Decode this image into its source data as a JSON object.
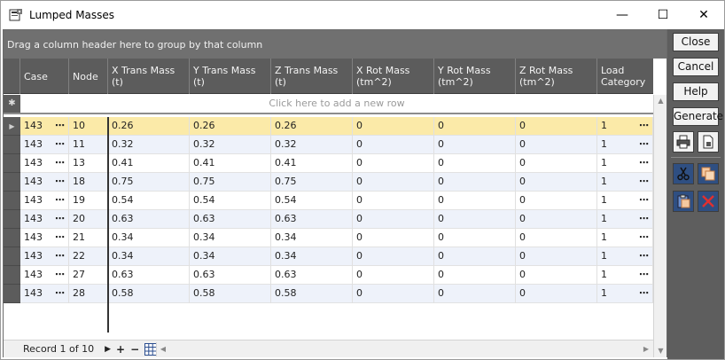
{
  "window": {
    "title": "Lumped Masses",
    "min_label": "—",
    "max_label": "☐",
    "close_label": "✕"
  },
  "grid": {
    "group_hint": "Drag a column header here to group by that column",
    "new_row_hint": "Click here to add a new row",
    "columns": [
      {
        "key": "case",
        "label": "Case"
      },
      {
        "key": "node",
        "label": "Node"
      },
      {
        "key": "xtm",
        "label": "X Trans Mass\n(t)"
      },
      {
        "key": "ytm",
        "label": "Y Trans Mass\n(t)"
      },
      {
        "key": "ztm",
        "label": "Z Trans Mass\n(t)"
      },
      {
        "key": "xrm",
        "label": "X Rot Mass\n(tm^2)"
      },
      {
        "key": "yrm",
        "label": "Y Rot Mass\n(tm^2)"
      },
      {
        "key": "zrm",
        "label": "Z Rot Mass\n(tm^2)"
      },
      {
        "key": "lc",
        "label": "Load\nCategory"
      }
    ],
    "rows": [
      {
        "case": "143",
        "node": "10",
        "xtm": "0.26",
        "ytm": "0.26",
        "ztm": "0.26",
        "xrm": "0",
        "yrm": "0",
        "zrm": "0",
        "lc": "1"
      },
      {
        "case": "143",
        "node": "11",
        "xtm": "0.32",
        "ytm": "0.32",
        "ztm": "0.32",
        "xrm": "0",
        "yrm": "0",
        "zrm": "0",
        "lc": "1"
      },
      {
        "case": "143",
        "node": "13",
        "xtm": "0.41",
        "ytm": "0.41",
        "ztm": "0.41",
        "xrm": "0",
        "yrm": "0",
        "zrm": "0",
        "lc": "1"
      },
      {
        "case": "143",
        "node": "18",
        "xtm": "0.75",
        "ytm": "0.75",
        "ztm": "0.75",
        "xrm": "0",
        "yrm": "0",
        "zrm": "0",
        "lc": "1"
      },
      {
        "case": "143",
        "node": "19",
        "xtm": "0.54",
        "ytm": "0.54",
        "ztm": "0.54",
        "xrm": "0",
        "yrm": "0",
        "zrm": "0",
        "lc": "1"
      },
      {
        "case": "143",
        "node": "20",
        "xtm": "0.63",
        "ytm": "0.63",
        "ztm": "0.63",
        "xrm": "0",
        "yrm": "0",
        "zrm": "0",
        "lc": "1"
      },
      {
        "case": "143",
        "node": "21",
        "xtm": "0.34",
        "ytm": "0.34",
        "ztm": "0.34",
        "xrm": "0",
        "yrm": "0",
        "zrm": "0",
        "lc": "1"
      },
      {
        "case": "143",
        "node": "22",
        "xtm": "0.34",
        "ytm": "0.34",
        "ztm": "0.34",
        "xrm": "0",
        "yrm": "0",
        "zrm": "0",
        "lc": "1"
      },
      {
        "case": "143",
        "node": "27",
        "xtm": "0.63",
        "ytm": "0.63",
        "ztm": "0.63",
        "xrm": "0",
        "yrm": "0",
        "zrm": "0",
        "lc": "1"
      },
      {
        "case": "143",
        "node": "28",
        "xtm": "0.58",
        "ytm": "0.58",
        "ztm": "0.58",
        "xrm": "0",
        "yrm": "0",
        "zrm": "0",
        "lc": "1"
      }
    ],
    "footer": {
      "record_label": "Record 1 of 10",
      "add_label": "+",
      "remove_label": "−"
    },
    "current_row_color": "#fbeaa8",
    "alt_row_color": "#eef2fa"
  },
  "panel": {
    "close_label": "Close",
    "cancel_label": "Cancel",
    "help_label": "Help",
    "generate_label": "Generate",
    "icons": [
      "print-icon",
      "export-icon",
      "cut-icon",
      "copy-icon",
      "paste-icon",
      "delete-icon"
    ]
  }
}
